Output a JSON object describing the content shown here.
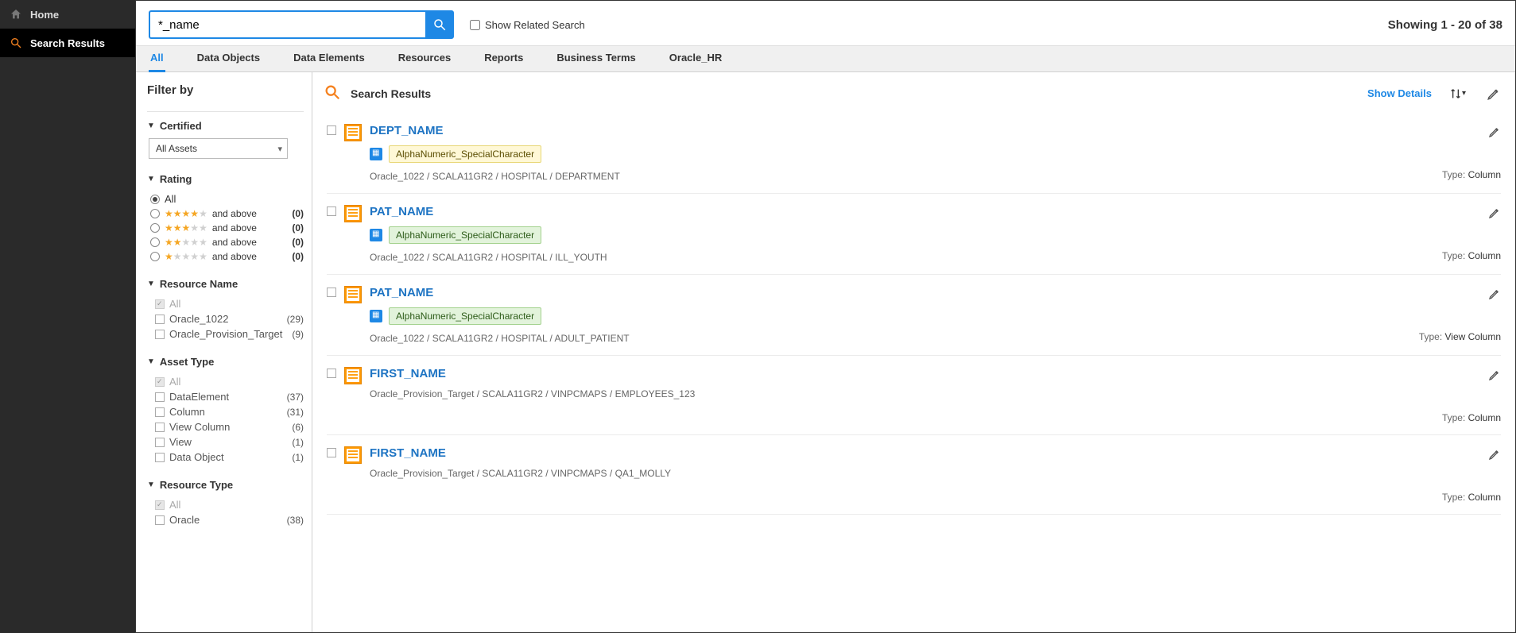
{
  "nav": {
    "home": "Home",
    "search_results": "Search Results"
  },
  "search": {
    "value": "*_name",
    "related_label": "Show Related Search"
  },
  "showing": "Showing 1 - 20 of 38",
  "tabs": {
    "all": "All",
    "data_objects": "Data Objects",
    "data_elements": "Data Elements",
    "resources": "Resources",
    "reports": "Reports",
    "business_terms": "Business Terms",
    "oracle_hr": "Oracle_HR"
  },
  "filter": {
    "title": "Filter by",
    "certified": {
      "label": "Certified",
      "value": "All Assets"
    },
    "rating": {
      "label": "Rating",
      "all": "All",
      "and_above": "and above",
      "counts": {
        "r4": "(0)",
        "r3": "(0)",
        "r2": "(0)",
        "r1": "(0)"
      }
    },
    "resource_name": {
      "label": "Resource Name",
      "all": "All",
      "items": [
        {
          "name": "Oracle_1022",
          "count": "(29)"
        },
        {
          "name": "Oracle_Provision_Target",
          "count": "(9)"
        }
      ]
    },
    "asset_type": {
      "label": "Asset Type",
      "all": "All",
      "items": [
        {
          "name": "DataElement",
          "count": "(37)"
        },
        {
          "name": "Column",
          "count": "(31)"
        },
        {
          "name": "View Column",
          "count": "(6)"
        },
        {
          "name": "View",
          "count": "(1)"
        },
        {
          "name": "Data Object",
          "count": "(1)"
        }
      ]
    },
    "resource_type": {
      "label": "Resource Type",
      "all": "All",
      "items": [
        {
          "name": "Oracle",
          "count": "(38)"
        }
      ]
    }
  },
  "results": {
    "title": "Search Results",
    "show_details": "Show Details",
    "type_label": "Type:",
    "items": [
      {
        "name": "DEPT_NAME",
        "tag": "AlphaNumeric_SpecialCharacter",
        "tag_color": "yellow",
        "path": "Oracle_1022 / SCALA11GR2 / HOSPITAL / DEPARTMENT",
        "type": "Column",
        "has_tag": true
      },
      {
        "name": "PAT_NAME",
        "tag": "AlphaNumeric_SpecialCharacter",
        "tag_color": "green",
        "path": "Oracle_1022 / SCALA11GR2 / HOSPITAL / ILL_YOUTH",
        "type": "Column",
        "has_tag": true
      },
      {
        "name": "PAT_NAME",
        "tag": "AlphaNumeric_SpecialCharacter",
        "tag_color": "green",
        "path": "Oracle_1022 / SCALA11GR2 / HOSPITAL / ADULT_PATIENT",
        "type": "View Column",
        "has_tag": true
      },
      {
        "name": "FIRST_NAME",
        "tag": "",
        "tag_color": "",
        "path": "Oracle_Provision_Target / SCALA11GR2 / VINPCMAPS / EMPLOYEES_123",
        "type": "Column",
        "has_tag": false
      },
      {
        "name": "FIRST_NAME",
        "tag": "",
        "tag_color": "",
        "path": "Oracle_Provision_Target / SCALA11GR2 / VINPCMAPS / QA1_MOLLY",
        "type": "Column",
        "has_tag": false
      }
    ]
  }
}
